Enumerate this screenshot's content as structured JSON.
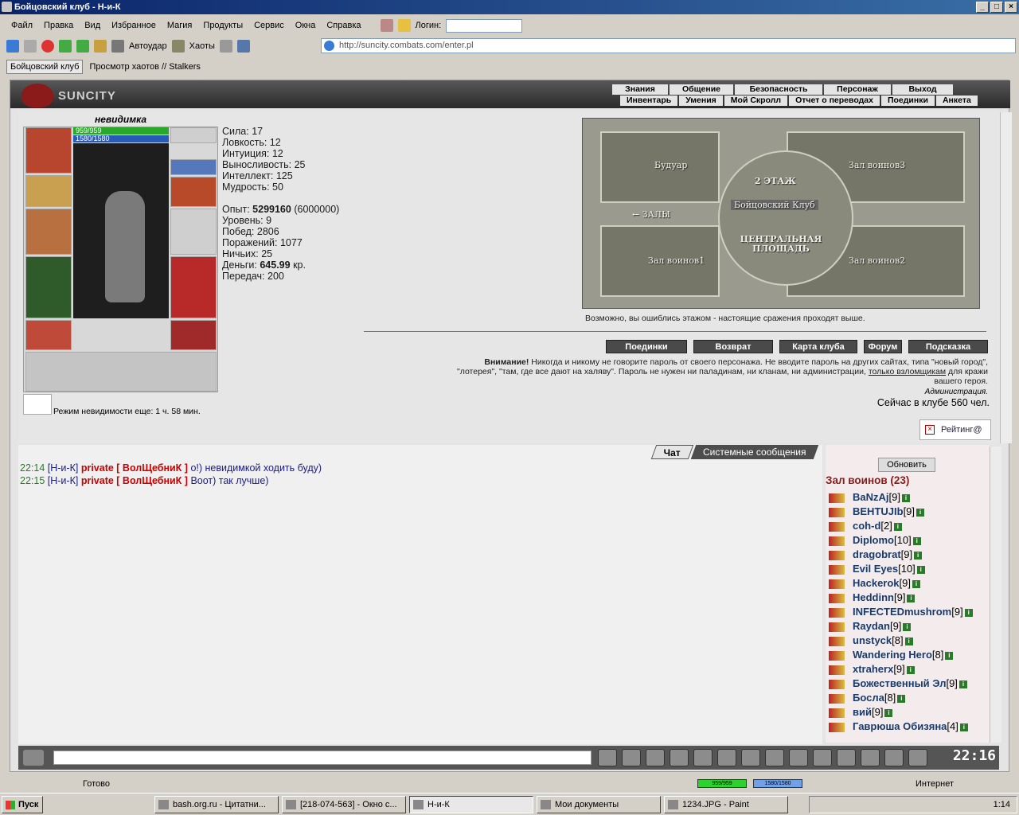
{
  "window": {
    "title": "Бойцовский клуб - Н-и-К",
    "buttons": [
      "_",
      "□",
      "×"
    ]
  },
  "menu": {
    "items": [
      "Файл",
      "Правка",
      "Вид",
      "Избранное",
      "Магия",
      "Продукты",
      "Сервис",
      "Окна",
      "Справка"
    ],
    "login_label": "Логин:"
  },
  "toolbar": {
    "autoudar": "Автоудар",
    "chaots": "Хаоты",
    "url": "http://suncity.combats.com/enter.pl"
  },
  "tabs": [
    "Бойцовский клуб",
    "Просмотр хаотов // Stalkers"
  ],
  "game": {
    "logo": "SUNCITY",
    "nav_row1": [
      "Знания",
      "Общение",
      "Безопасность",
      "Персонаж",
      "Выход"
    ],
    "nav_row2": [
      "Инвентарь",
      "Умения",
      "Мой Скролл",
      "Отчет о переводах",
      "Поединки",
      "Анкета"
    ],
    "char_name": "невидимка",
    "hp": "959/959",
    "mana": "1580/1580",
    "stats": {
      "strength": "Сила: 17",
      "agility": "Ловкость: 12",
      "intuition": "Интуиция: 12",
      "endurance": "Выносливость: 25",
      "intellect": "Интеллект: 125",
      "wisdom": "Мудрость: 50",
      "exp_label": "Опыт:",
      "exp_value": "5299160",
      "exp_next": "(6000000)",
      "level": "Уровень: 9",
      "wins": "Побед: 2806",
      "losses": "Поражений: 1077",
      "draws": "Ничьих: 25",
      "money_label": "Деньги:",
      "money_value": "645.99",
      "money_unit": "кр.",
      "transfers": "Передач: 200"
    },
    "invis_text": "Режим невидимости еще: 1 ч. 58 мин.",
    "map": {
      "rooms": [
        "Будуар",
        "Зал воинов3",
        "Зал воинов1",
        "Зал воинов2"
      ],
      "floor": "2 ЭТАЖ",
      "club": "Бойцовский Клуб",
      "halls": "← ЗАЛЫ",
      "center": "ЦЕНТРАЛЬНАЯ ПЛОЩАДЬ",
      "note": "Возможно, вы ошиблись этажом - настоящие сражения проходят выше."
    },
    "buttons": [
      "Поединки",
      "Возврат",
      "Карта клуба",
      "Форум",
      "Подсказка"
    ],
    "warning": {
      "bold": "Внимание!",
      "text1": " Никогда и никому не говорите пароль от своего персонажа. Не вводите пароль на других сайтах, типа \"новый город\",",
      "text2": "\"лотерея\", \"там, где все дают на халяву\". Пароль не нужен ни паладинам, ни кланам, ни администрации,",
      "link": "только взломщикам",
      "text3": " для кражи",
      "text4": "вашего героя.",
      "admin": "Администрация."
    },
    "online": "Сейчас в клубе 560 чел.",
    "rating": "Рейтинг@"
  },
  "chat": {
    "tabs": [
      "Чат",
      "Системные сообщения"
    ],
    "messages": [
      {
        "time": "22:14",
        "from": "[Н-и-К]",
        "priv": "private [ ВолЩебниК ]",
        "text": "о!) невидимкой ходить буду)"
      },
      {
        "time": "22:15",
        "from": "[Н-и-К]",
        "priv": "private [ ВолЩебниК ]",
        "text": "Воот) так лучше)"
      }
    ]
  },
  "users": {
    "refresh": "Обновить",
    "room": "Зал воинов (23)",
    "list": [
      {
        "name": "BaNzAj",
        "lvl": "[9]"
      },
      {
        "name": "BEHTUJIb",
        "lvl": "[9]"
      },
      {
        "name": "coh-d",
        "lvl": "[2]"
      },
      {
        "name": "Diplomo",
        "lvl": "[10]"
      },
      {
        "name": "dragobrat",
        "lvl": "[9]"
      },
      {
        "name": "Evil Eyes",
        "lvl": "[10]"
      },
      {
        "name": "Hackerok",
        "lvl": "[9]"
      },
      {
        "name": "Heddinn",
        "lvl": "[9]"
      },
      {
        "name": "INFECTEDmushrom",
        "lvl": "[9]"
      },
      {
        "name": "Raydan",
        "lvl": "[9]"
      },
      {
        "name": "unstyck",
        "lvl": "[8]"
      },
      {
        "name": "Wandering Hero",
        "lvl": "[8]"
      },
      {
        "name": "xtraherx",
        "lvl": "[9]"
      },
      {
        "name": "Божественный Эл",
        "lvl": "[9]"
      },
      {
        "name": "Босла",
        "lvl": "[8]"
      },
      {
        "name": "вий",
        "lvl": "[9]"
      },
      {
        "name": "Гаврюша Обизяна",
        "lvl": "[4]"
      }
    ]
  },
  "clock": "22:16",
  "status": {
    "text": "Готово",
    "hp": "959/959",
    "mana": "1580/1580",
    "zone": "Интернет"
  },
  "taskbar": {
    "start": "Пуск",
    "tasks": [
      "bash.org.ru - Цитатни...",
      "[218-074-563] - Окно с...",
      "Н-и-К",
      "Мои документы",
      "1234.JPG - Paint"
    ],
    "time": "1:14"
  }
}
